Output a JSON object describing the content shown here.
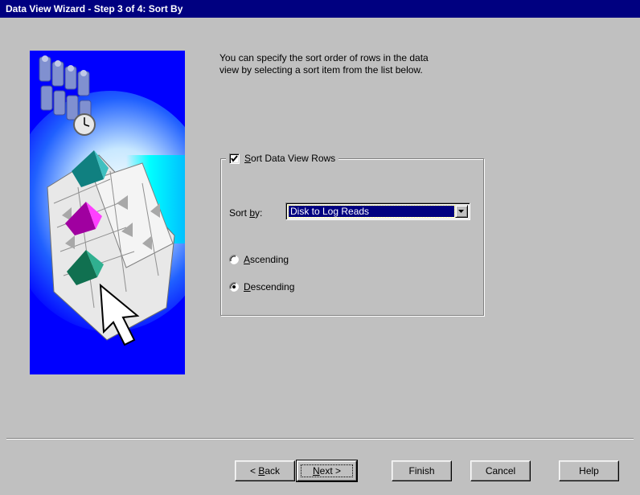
{
  "window": {
    "title": "Data View Wizard - Step 3 of 4:  Sort By"
  },
  "description": {
    "line1": "You can specify the sort order of rows in the data",
    "line2": "view by selecting a sort item from the list below."
  },
  "sort_group": {
    "checkbox_label_mnemonic": "S",
    "checkbox_label_rest": "ort Data View Rows",
    "checked": true,
    "sort_by_prefix": "Sort ",
    "sort_by_mnemonic": "b",
    "sort_by_suffix": "y:",
    "sort_by_value": "Disk to Log Reads",
    "ascending_mnemonic": "A",
    "ascending_rest": "scending",
    "descending_mnemonic": "D",
    "descending_rest": "escending",
    "selected_order": "Descending"
  },
  "buttons": {
    "back_prefix": "< ",
    "back_mnemonic": "B",
    "back_rest": "ack",
    "next_mnemonic": "N",
    "next_rest": "ext >",
    "finish": "Finish",
    "cancel": "Cancel",
    "help": "Help"
  },
  "colors": {
    "title_bar": "#000080",
    "dialog_bg": "#c0c0c0",
    "selection": "#000080",
    "illustration_bg": "#0000ff"
  },
  "icons": [
    "wizard-illustration",
    "checkbox-check-icon",
    "dropdown-arrow-icon",
    "radio-dot-icon"
  ]
}
